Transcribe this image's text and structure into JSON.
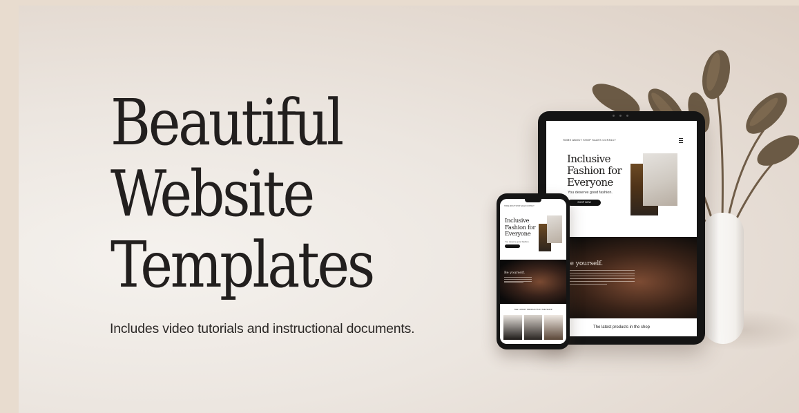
{
  "banner": {
    "headline_lines": [
      "Beautiful",
      "Website",
      "Templates"
    ],
    "subtitle": "Includes video tutorials and instructional documents."
  },
  "tablet": {
    "nav": "HOME  ABOUT  SHOP  SALES  CONTACT",
    "hero_lines": [
      "Inclusive",
      "Fashion for",
      "Everyone"
    ],
    "tagline": "You deserve good fashion.",
    "cta": "SHOP NOW",
    "feature_title": "Be yourself.",
    "footer_heading": "The latest products in the shop"
  },
  "phone": {
    "hero_lines": [
      "Inclusive",
      "Fashion for",
      "Everyone"
    ],
    "feature_title": "Be yourself.",
    "footer_heading": "THE LATEST PRODUCTS IN THE SHOP"
  },
  "colors": {
    "text_dark": "#221f1e",
    "background": "#ece6e0",
    "accent_dark": "#141414",
    "plant_brown": "#6b5a45"
  }
}
